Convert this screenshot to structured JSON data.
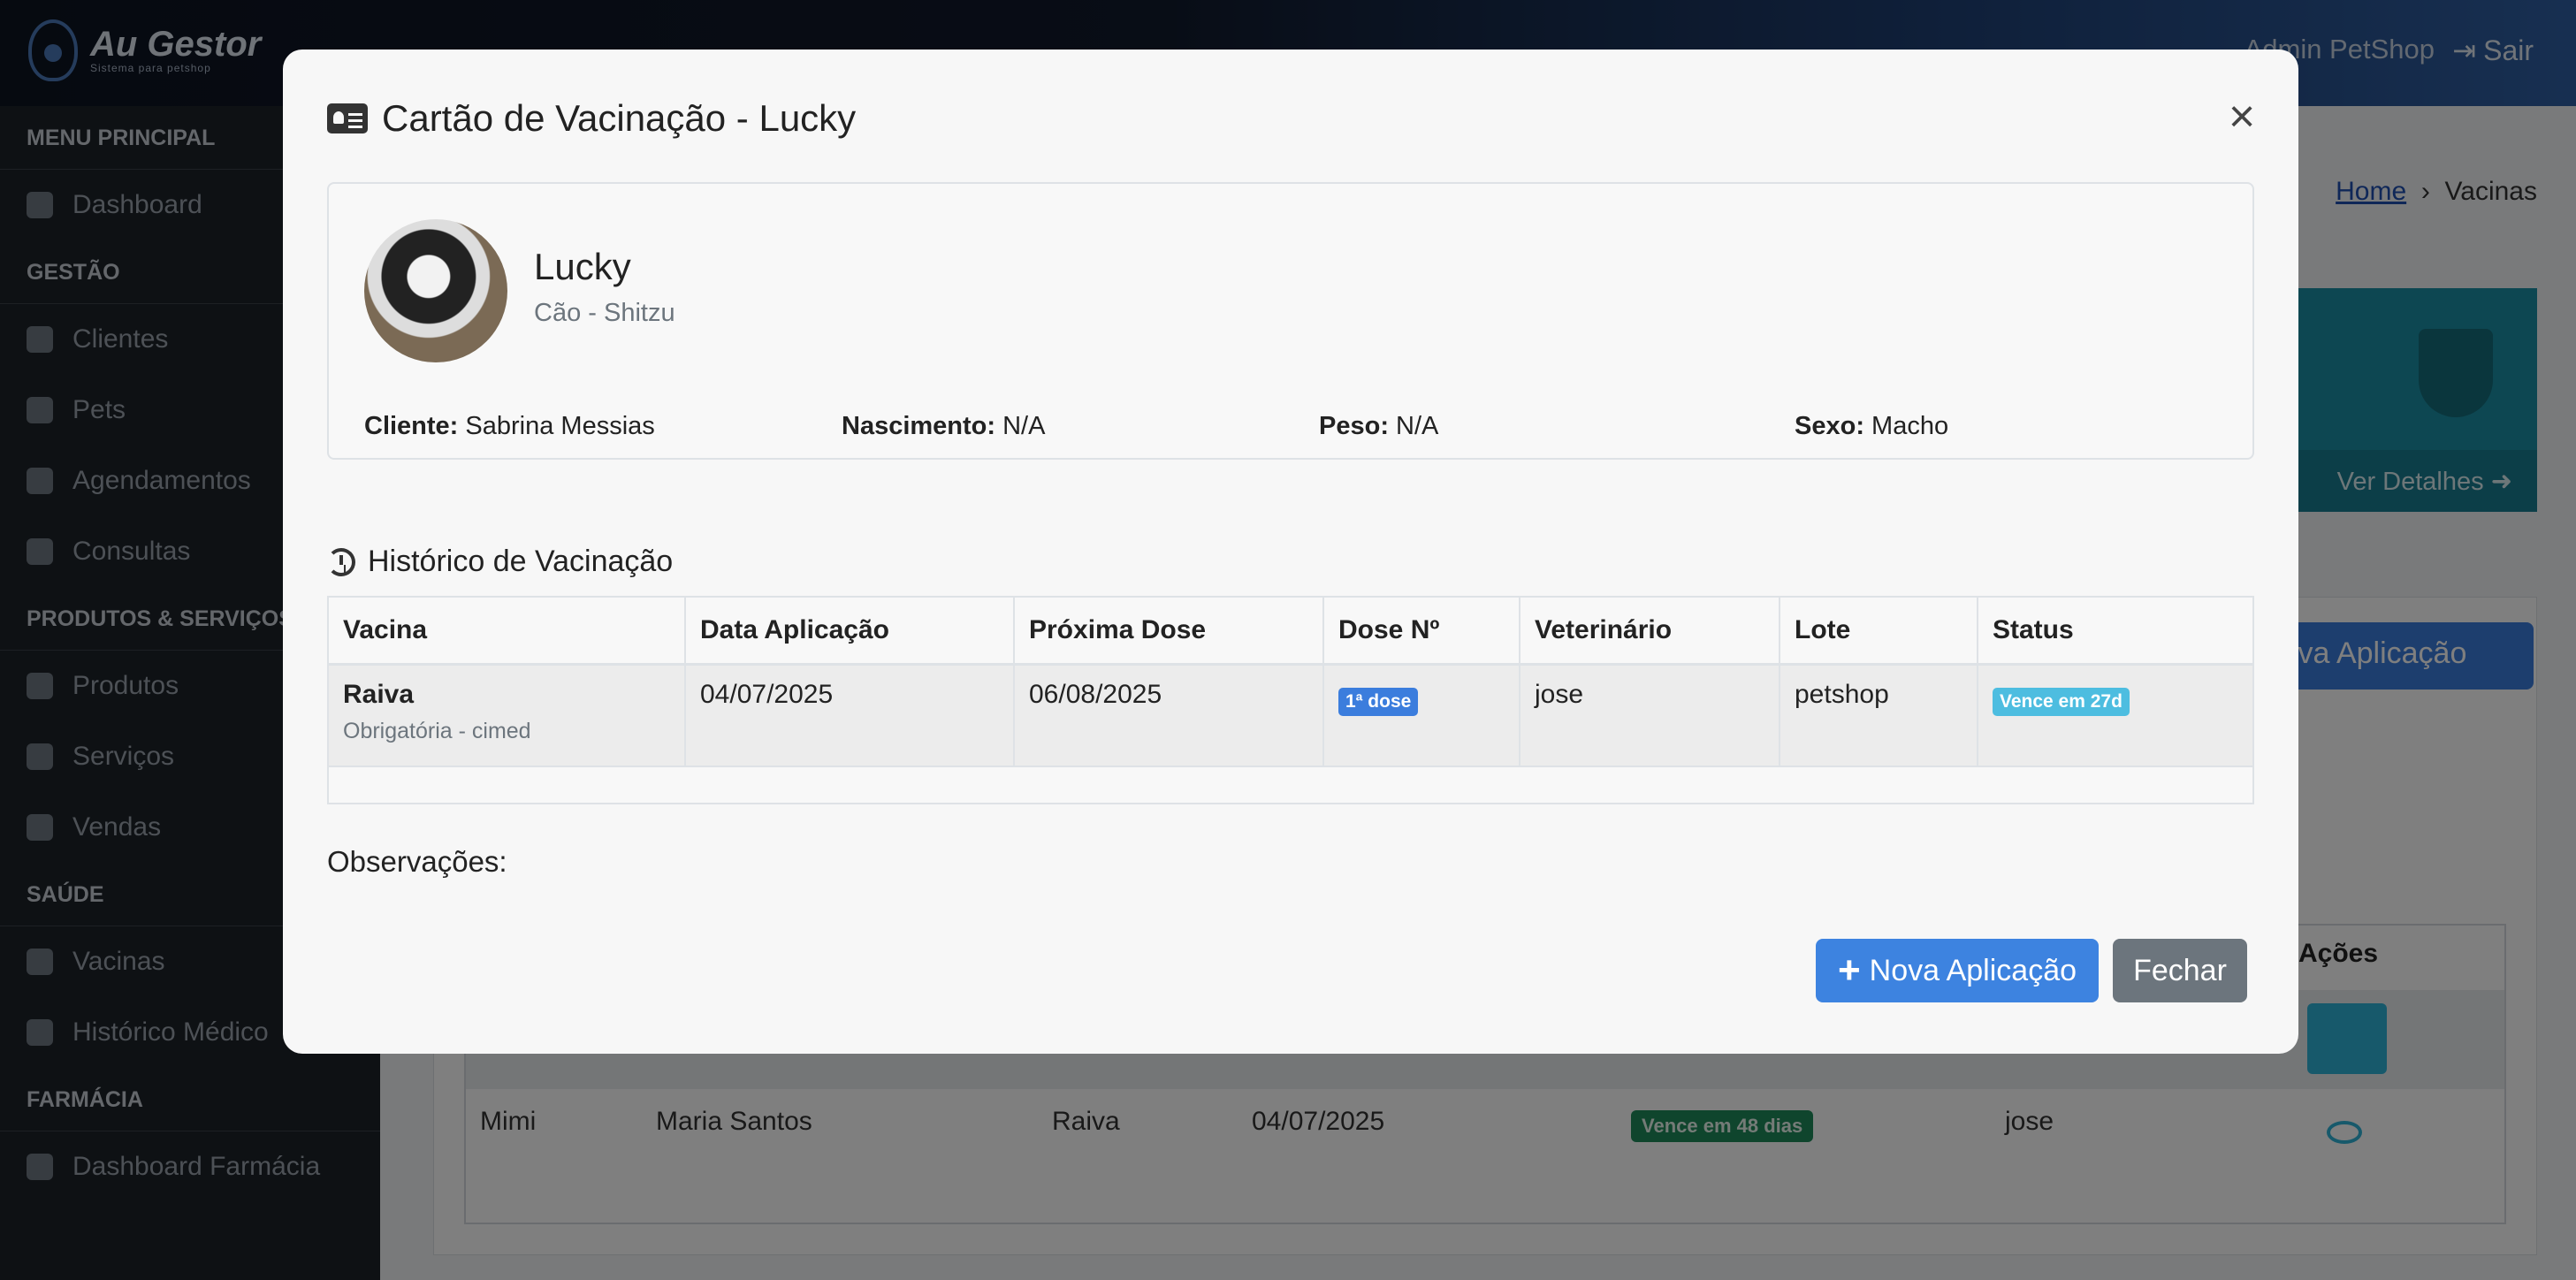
{
  "app": {
    "logo_text": "Au Gestor",
    "logo_tagline": "Sistema para petshop",
    "user_name": "Admin PetShop",
    "logout_label": "Sair"
  },
  "sidebar": {
    "sections": [
      {
        "header": "MENU PRINCIPAL",
        "items": [
          {
            "label": "Dashboard",
            "icon": "dashboard-icon"
          }
        ]
      },
      {
        "header": "GESTÃO",
        "items": [
          {
            "label": "Clientes",
            "icon": "users-icon"
          },
          {
            "label": "Pets",
            "icon": "paw-icon"
          },
          {
            "label": "Agendamentos",
            "icon": "calendar-icon"
          },
          {
            "label": "Consultas",
            "icon": "stethoscope-icon"
          }
        ]
      },
      {
        "header": "PRODUTOS & SERVIÇOS",
        "items": [
          {
            "label": "Produtos",
            "icon": "box-icon"
          },
          {
            "label": "Serviços",
            "icon": "stethoscope-icon"
          },
          {
            "label": "Vendas",
            "icon": "cart-icon"
          }
        ]
      },
      {
        "header": "SAÚDE",
        "items": [
          {
            "label": "Vacinas",
            "icon": "syringe-icon"
          },
          {
            "label": "Histórico Médico",
            "icon": "file-medical-icon"
          }
        ]
      },
      {
        "header": "FARMÁCIA",
        "items": [
          {
            "label": "Dashboard Farmácia",
            "icon": "chart-pie-icon"
          }
        ]
      }
    ]
  },
  "breadcrumb": {
    "home": "Home",
    "current": "Vacinas"
  },
  "info_card": {
    "footer": "Ver Detalhes"
  },
  "panel": {
    "new_button": "Nova Aplicação",
    "actions_header": "Ações"
  },
  "bg_row": {
    "pet": "Mimi",
    "client": "Maria Santos",
    "vaccine": "Raiva",
    "date": "04/07/2025",
    "status": "Vence em 48 dias",
    "vet": "jose"
  },
  "modal": {
    "title": "Cartão de Vacinação - Lucky",
    "pet": {
      "name": "Lucky",
      "breed": "Cão - Shitzu",
      "client_label": "Cliente:",
      "client": "Sabrina Messias",
      "birth_label": "Nascimento:",
      "birth": "N/A",
      "weight_label": "Peso:",
      "weight": "N/A",
      "sex_label": "Sexo:",
      "sex": "Macho"
    },
    "history_title": "Histórico de Vacinação",
    "table": {
      "headers": [
        "Vacina",
        "Data Aplicação",
        "Próxima Dose",
        "Dose Nº",
        "Veterinário",
        "Lote",
        "Status"
      ],
      "rows": [
        {
          "vaccine": "Raiva",
          "vaccine_sub": "Obrigatória - cimed",
          "applied": "04/07/2025",
          "next": "06/08/2025",
          "dose": "1ª dose",
          "vet": "jose",
          "lot": "petshop",
          "status": "Vence em 27d"
        }
      ]
    },
    "observations_label": "Observações:",
    "new_button": "Nova Aplicação",
    "close_button": "Fechar"
  },
  "colors": {
    "primary": "#3b7ddd",
    "info": "#4dbde0",
    "secondary": "#6c757d",
    "sidebar": "#1d2229"
  }
}
